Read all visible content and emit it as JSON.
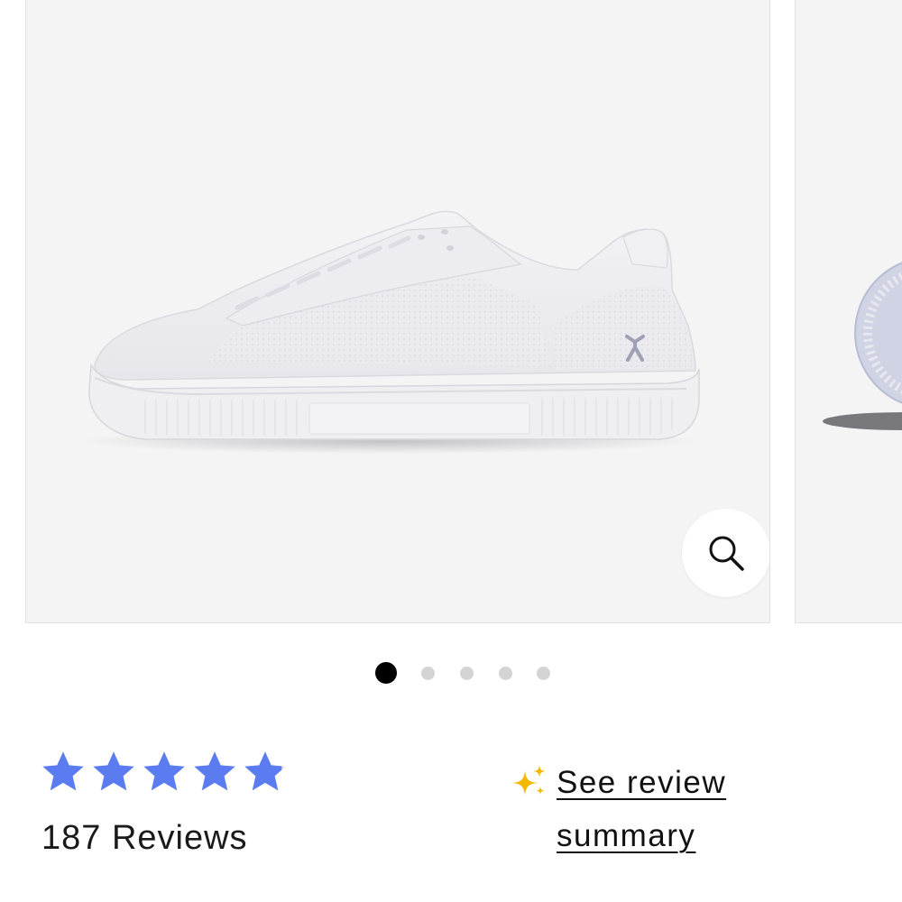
{
  "gallery": {
    "image_alt": "White knit low-top sneaker, side view",
    "zoom_icon": "magnifier-icon",
    "slide_count": 5,
    "active_slide": 1
  },
  "rating": {
    "stars": 5,
    "value": 4.9,
    "star_color": "#5b7cf0",
    "reviews_label": "187 Reviews"
  },
  "summary": {
    "icon": "sparkle-icon",
    "link_text": "See review summary",
    "sparkle_color": "#f5b800"
  }
}
